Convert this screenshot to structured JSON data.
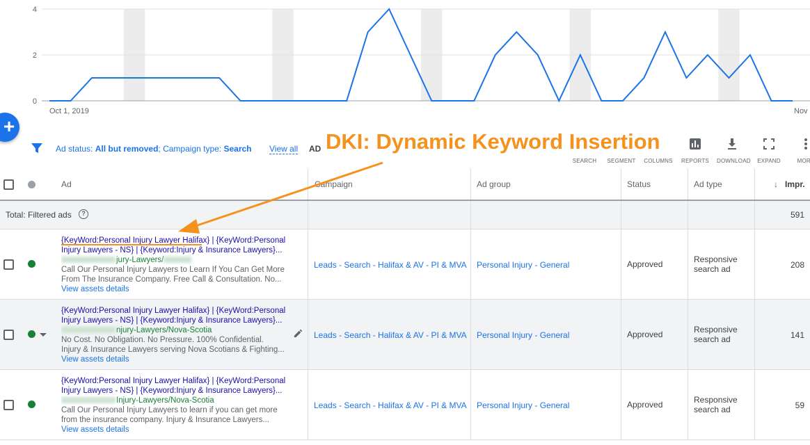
{
  "chart_data": {
    "type": "line",
    "x_start_label": "Oct 1, 2019",
    "x_end_label": "Nov",
    "y_ticks": [
      0,
      2,
      4
    ],
    "ylim": [
      0,
      4
    ],
    "series_color": "#1a73e8",
    "values": [
      0,
      0,
      1,
      1,
      1,
      1,
      1,
      1,
      1,
      0,
      0,
      0,
      0,
      0,
      0,
      3,
      4,
      2,
      0,
      0,
      0,
      2,
      3,
      2,
      0,
      2,
      0,
      0,
      1,
      3,
      1,
      2,
      1,
      2,
      0,
      0
    ],
    "weekend_bands_at_index": [
      4,
      11,
      18,
      25,
      32
    ]
  },
  "fab": {
    "label": "+"
  },
  "filters": {
    "ad_status_label": "Ad status:",
    "ad_status_value": "All but removed",
    "sep": ";",
    "campaign_type_label": "Campaign type:",
    "campaign_type_value": "Search",
    "view_all": "View all",
    "add_label": "ADI"
  },
  "toolbar": [
    {
      "icon": "search-icon",
      "label": "SEARCH"
    },
    {
      "icon": "segment-icon",
      "label": "SEGMENT"
    },
    {
      "icon": "columns-icon",
      "label": "COLUMNS"
    },
    {
      "icon": "reports-icon",
      "label": "REPORTS"
    },
    {
      "icon": "download-icon",
      "label": "DOWNLOAD"
    },
    {
      "icon": "expand-icon",
      "label": "EXPAND"
    },
    {
      "icon": "more-icon",
      "label": "MORE"
    }
  ],
  "annotation": {
    "text": "DKI: Dynamic Keyword Insertion",
    "color": "#f5921e"
  },
  "table": {
    "headers": {
      "ad": "Ad",
      "campaign": "Campaign",
      "ad_group": "Ad group",
      "status": "Status",
      "ad_type": "Ad type",
      "impr": "Impr."
    },
    "total": {
      "label": "Total: Filtered ads",
      "help": "?",
      "impr": "591"
    },
    "rows": [
      {
        "headline1": "{KeyWord:Personal Injury Lawyer Halifax} | {KeyWord:Personal",
        "headline2": "Injury Lawyers - NS} | {Keyword:Injury & Insurance Lawyers}...",
        "url": "jury-Lawyers/",
        "desc1": "Call Our Personal Injury Lawyers to Learn If You Can Get More",
        "desc2": "From The Insurance Company. Free Call & Consultation. No...",
        "assets": "View assets details",
        "campaign": "Leads - Search - Halifax & AV - PI & MVA",
        "ad_group": "Personal Injury - General",
        "status": "Approved",
        "ad_type_1": "Responsive",
        "ad_type_2": "search ad",
        "impr": "208"
      },
      {
        "headline1": "{KeyWord:Personal Injury Lawyer Halifax} | {KeyWord:Personal",
        "headline2": "Injury Lawyers - NS} | {Keyword:Injury & Insurance Lawyers}...",
        "url": "njury-Lawyers/Nova-Scotia",
        "desc1": "No Cost. No Obligation. No Pressure. 100% Confidential.",
        "desc2": "Injury & Insurance Lawyers serving Nova Scotians & Fighting...",
        "assets": "View assets details",
        "campaign": "Leads - Search - Halifax & AV - PI & MVA",
        "ad_group": "Personal Injury - General",
        "status": "Approved",
        "ad_type_1": "Responsive",
        "ad_type_2": "search ad",
        "impr": "141"
      },
      {
        "headline1": "{KeyWord:Personal Injury Lawyer Halifax} | {KeyWord:Personal",
        "headline2": "Injury Lawyers - NS} | {Keyword:Injury & Insurance Lawyers}...",
        "url": "Injury-Lawyers/Nova-Scotia",
        "desc1": "Call Our Personal Injury Lawyers to learn if you can get more",
        "desc2": "from the insurance company. Injury & Insurance Lawyers...",
        "assets": "View assets details",
        "campaign": "Leads - Search - Halifax & AV - PI & MVA",
        "ad_group": "Personal Injury - General",
        "status": "Approved",
        "ad_type_1": "Responsive",
        "ad_type_2": "search ad",
        "impr": "59"
      }
    ]
  }
}
